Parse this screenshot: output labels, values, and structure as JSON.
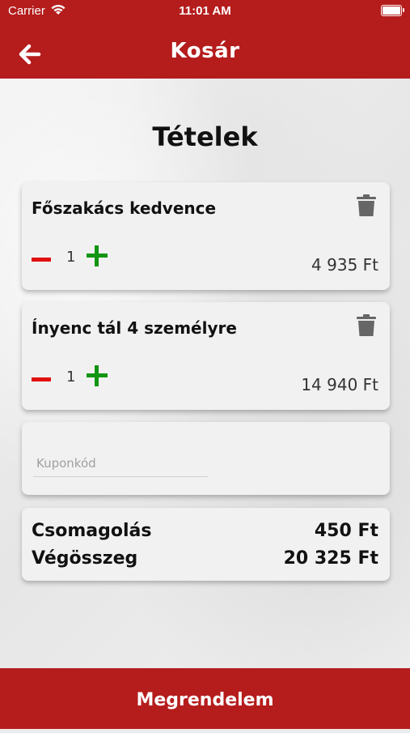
{
  "status_bar": {
    "carrier": "Carrier",
    "time": "11:01 AM"
  },
  "header": {
    "title": "Kosár",
    "back_icon": "arrow-left-icon"
  },
  "section_title": "Tételek",
  "items": [
    {
      "name": "Főszakács kedvence",
      "quantity": "1",
      "price": "4 935 Ft"
    },
    {
      "name": "Ínyenc tál 4 személyre",
      "quantity": "1",
      "price": "14 940 Ft"
    }
  ],
  "coupon": {
    "placeholder": "Kuponkód",
    "value": ""
  },
  "summary": {
    "packaging_label": "Csomagolás",
    "packaging_value": "450 Ft",
    "total_label": "Végösszeg",
    "total_value": "20 325 Ft"
  },
  "footer": {
    "order_button": "Megrendelem"
  },
  "colors": {
    "brand": "#b51c1c",
    "minus": "#e01010",
    "plus": "#129512"
  }
}
